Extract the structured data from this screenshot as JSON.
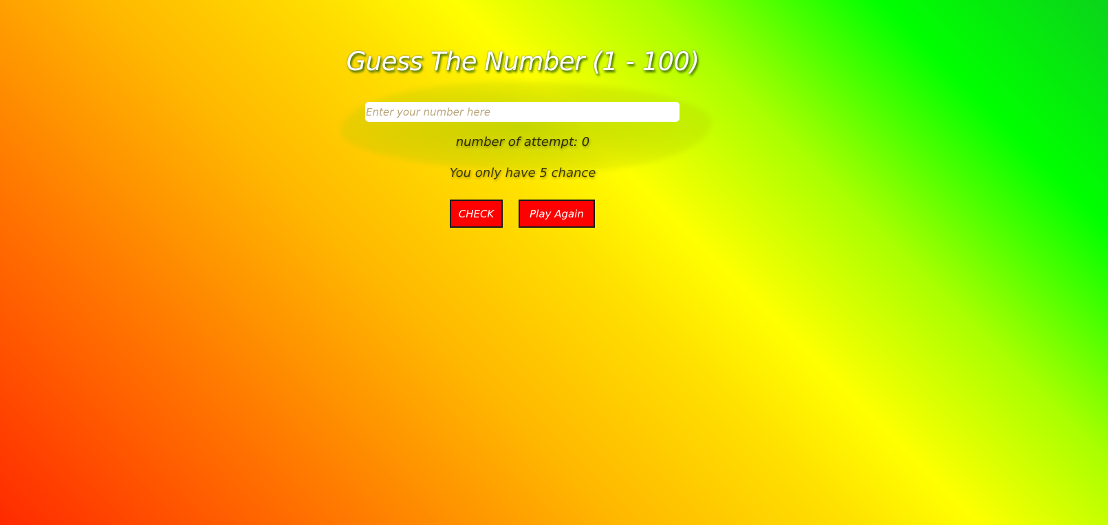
{
  "game": {
    "title": "Guess The Number (1 - 100)",
    "input_placeholder": "Enter your number here",
    "input_value": "",
    "attempts_text": "number of attempt: 0",
    "chances_text": "You only have 5 chance",
    "check_label": "CHECK",
    "play_again_label": "Play Again"
  },
  "colors": {
    "button_bg": "#ff0000",
    "button_text": "#ffffff",
    "title_text": "#ffffff",
    "gradient_start": "#ff2a00",
    "gradient_mid": "#ffff00",
    "gradient_end": "#0bd41b"
  }
}
